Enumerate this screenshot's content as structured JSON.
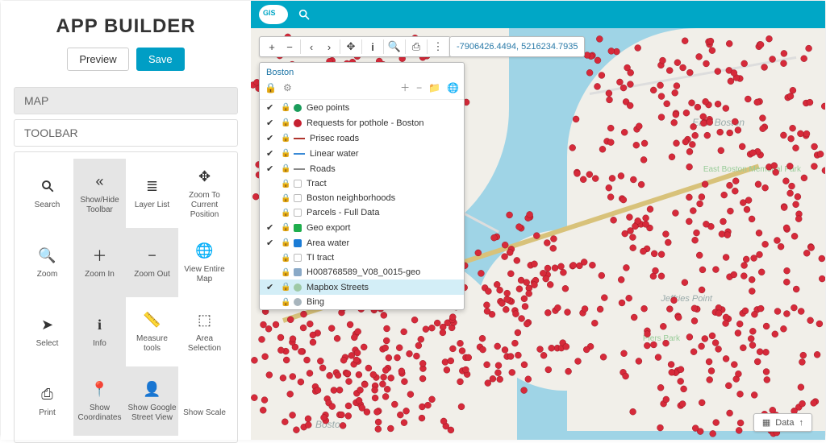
{
  "app": {
    "title": "APP BUILDER"
  },
  "buttons": {
    "preview": "Preview",
    "save": "Save"
  },
  "sections": {
    "map": "MAP",
    "toolbar": "TOOLBAR"
  },
  "tools": [
    {
      "icon": "search",
      "label": "Search",
      "active": false
    },
    {
      "icon": "chev2",
      "label": "Show/Hide Toolbar",
      "active": true
    },
    {
      "icon": "list",
      "label": "Layer List",
      "active": false
    },
    {
      "icon": "target",
      "label": "Zoom To Current Position",
      "active": false
    },
    {
      "icon": "zoom",
      "label": "Zoom",
      "active": false
    },
    {
      "icon": "plus",
      "label": "Zoom In",
      "active": true
    },
    {
      "icon": "minus",
      "label": "Zoom Out",
      "active": true
    },
    {
      "icon": "globe",
      "label": "View Entire Map",
      "active": false
    },
    {
      "icon": "cursor",
      "label": "Select",
      "active": false
    },
    {
      "icon": "info",
      "label": "Info",
      "active": true
    },
    {
      "icon": "ruler",
      "label": "Measure tools",
      "active": false
    },
    {
      "icon": "dsel",
      "label": "Area Selection",
      "active": false
    },
    {
      "icon": "print",
      "label": "Print",
      "active": false
    },
    {
      "icon": "pin",
      "label": "Show Coordinates",
      "active": true
    },
    {
      "icon": "street",
      "label": "Show Google Street View",
      "active": true
    },
    {
      "icon": "",
      "label": "Show Scale",
      "active": false
    }
  ],
  "map": {
    "coords": "-7906426.4494, 5216234.7935",
    "project_name": "Boston",
    "data_button": "Data"
  },
  "layers": [
    {
      "checked": true,
      "swatch": "#1a9c5b",
      "shape": "circle",
      "label": "Geo points"
    },
    {
      "checked": true,
      "swatch": "#c62031",
      "shape": "circle",
      "label": "Requests for pothole - Boston"
    },
    {
      "checked": true,
      "swatch": "#b0352e",
      "shape": "line",
      "label": "Prisec roads"
    },
    {
      "checked": true,
      "swatch": "#3a8ad6",
      "shape": "line",
      "label": "Linear water"
    },
    {
      "checked": true,
      "swatch": "#888888",
      "shape": "line",
      "label": "Roads"
    },
    {
      "checked": false,
      "swatch": "#ffffff",
      "shape": "square",
      "label": "Tract"
    },
    {
      "checked": false,
      "swatch": "#ffffff",
      "shape": "square",
      "label": "Boston neighborhoods"
    },
    {
      "checked": false,
      "swatch": "#ffffff",
      "shape": "square",
      "label": "Parcels - Full Data"
    },
    {
      "checked": true,
      "swatch": "#1fae4d",
      "shape": "square",
      "label": "Geo export"
    },
    {
      "checked": true,
      "swatch": "#1b7cd6",
      "shape": "square",
      "label": "Area water"
    },
    {
      "checked": false,
      "swatch": "#ffffff",
      "shape": "square",
      "label": "TI tract"
    },
    {
      "checked": false,
      "swatch": "#8aa9c7",
      "shape": "square",
      "label": "H008768589_V08_0015-geo"
    },
    {
      "checked": true,
      "swatch": "#9ec9a6",
      "shape": "circle",
      "label": "Mapbox Streets",
      "selected": true
    },
    {
      "checked": false,
      "swatch": "#a8b5bd",
      "shape": "circle",
      "label": "Bing"
    }
  ],
  "map_labels": {
    "east_boston": "East Boston",
    "park": "East Boston Memorial Park",
    "boston": "Boston",
    "piers": "Piers Park",
    "jeffries": "Jeffries Point"
  }
}
